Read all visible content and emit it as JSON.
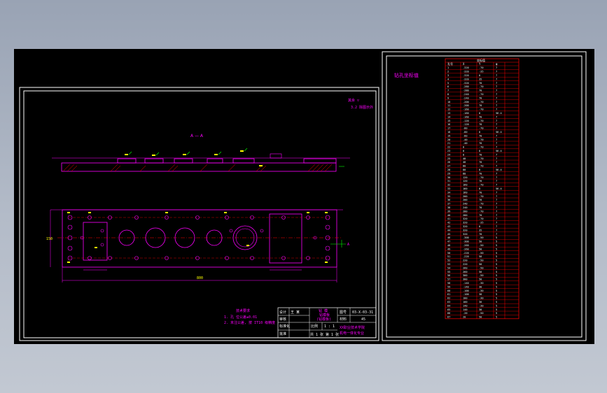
{
  "colors": {
    "background": "#000000",
    "frame": "#ffffff",
    "part_outline": "#ff00ff",
    "dimension": "#ff00ff",
    "centerline": "#ff0000",
    "hatch": "#ff0000",
    "table_grid": "#ff0000",
    "marker": "#ffff00",
    "leader": "#00ff00"
  },
  "drawing": {
    "section_label": "A — A",
    "view_arrow_label": "A",
    "top_right_note": [
      "其余 ▽",
      "3.2 除图示外"
    ],
    "tech_requirements": {
      "title": "技术要求",
      "lines": [
        "1. 孔 位公差±0.01",
        "2. 未注公差, 按 IT10 级精度"
      ]
    },
    "overall_dimension": "800",
    "side_dimension": "150"
  },
  "title_block": {
    "designer_label": "设计",
    "designer_name": "王 某",
    "checker_label": "审核",
    "standard_label": "标准化",
    "approve_label": "批准",
    "title_top": "钻 模",
    "title_sub": "(钻模板)",
    "title_center": "钻模板",
    "drawing_no_label": "图号",
    "drawing_no": "03-X-03-31",
    "material_label": "材料",
    "material": "45",
    "scale_label": "比例",
    "scale": "1 : 1",
    "sheet": "共 1 张 第 1 张",
    "school": "XX职业技术学院",
    "class": "机电一体化专业"
  },
  "coordinate_table": {
    "title": "钻孔坐标值",
    "header_caption": "坐标值",
    "columns": [
      "孔号",
      "X",
      "Y",
      "φ"
    ],
    "rows": [
      [
        "1",
        "-320",
        "-70",
        "7"
      ],
      [
        "2",
        "-320",
        "-35",
        "7"
      ],
      [
        "3",
        "-320",
        "0",
        "7"
      ],
      [
        "4",
        "-320",
        "35",
        "7"
      ],
      [
        "5",
        "-320",
        "70",
        "7"
      ],
      [
        "6",
        "-280",
        "-70",
        "7"
      ],
      [
        "7",
        "-280",
        "70",
        "7"
      ],
      [
        "8",
        "-240",
        "-70",
        "7"
      ],
      [
        "9",
        "-240",
        "70",
        "7"
      ],
      [
        "10",
        "-200",
        "-70",
        "7"
      ],
      [
        "11",
        "-200",
        "70",
        "7"
      ],
      [
        "12",
        "-160",
        "-70",
        "7"
      ],
      [
        "13",
        "-160",
        "0",
        "56.4"
      ],
      [
        "14",
        "-160",
        "70",
        "7"
      ],
      [
        "15",
        "-120",
        "-70",
        "7"
      ],
      [
        "16",
        "-120",
        "70",
        "7"
      ],
      [
        "17",
        "-80",
        "-70",
        "7"
      ],
      [
        "18",
        "-80",
        "0",
        "56.4"
      ],
      [
        "19",
        "-80",
        "70",
        "7"
      ],
      [
        "20",
        "-40",
        "-70",
        "7"
      ],
      [
        "21",
        "-40",
        "70",
        "7"
      ],
      [
        "22",
        "0",
        "-70",
        "7"
      ],
      [
        "23",
        "0",
        "0",
        "56.4"
      ],
      [
        "24",
        "0",
        "70",
        "7"
      ],
      [
        "25",
        "40",
        "-70",
        "7"
      ],
      [
        "26",
        "40",
        "70",
        "7"
      ],
      [
        "27",
        "80",
        "-70",
        "7"
      ],
      [
        "28",
        "80",
        "0",
        "56.4"
      ],
      [
        "29",
        "80",
        "70",
        "7"
      ],
      [
        "30",
        "120",
        "-70",
        "7"
      ],
      [
        "31",
        "120",
        "70",
        "7"
      ],
      [
        "32",
        "160",
        "-70",
        "7"
      ],
      [
        "33",
        "160",
        "0",
        "56.4"
      ],
      [
        "34",
        "160",
        "70",
        "7"
      ],
      [
        "35",
        "200",
        "-70",
        "7"
      ],
      [
        "36",
        "200",
        "70",
        "7"
      ],
      [
        "37",
        "240",
        "-70",
        "7"
      ],
      [
        "38",
        "240",
        "70",
        "7"
      ],
      [
        "39",
        "280",
        "-70",
        "7"
      ],
      [
        "40",
        "280",
        "70",
        "7"
      ],
      [
        "41",
        "320",
        "-70",
        "7"
      ],
      [
        "42",
        "320",
        "-35",
        "7"
      ],
      [
        "43",
        "320",
        "0",
        "7"
      ],
      [
        "44",
        "320",
        "35",
        "7"
      ],
      [
        "45",
        "320",
        "70",
        "7"
      ],
      [
        "46",
        "-300",
        "-50",
        "5"
      ],
      [
        "47",
        "-300",
        "50",
        "5"
      ],
      [
        "48",
        "-260",
        "-50",
        "5"
      ],
      [
        "49",
        "-260",
        "50",
        "5"
      ],
      [
        "50",
        "-220",
        "-50",
        "5"
      ],
      [
        "51",
        "-220",
        "50",
        "5"
      ],
      [
        "52",
        "220",
        "-50",
        "5"
      ],
      [
        "53",
        "220",
        "50",
        "5"
      ],
      [
        "54",
        "260",
        "-50",
        "5"
      ],
      [
        "55",
        "260",
        "50",
        "5"
      ],
      [
        "56",
        "300",
        "-50",
        "5"
      ],
      [
        "57",
        "300",
        "50",
        "5"
      ],
      [
        "58",
        "-140",
        "-30",
        "5"
      ],
      [
        "59",
        "-140",
        "30",
        "5"
      ],
      [
        "60",
        "-100",
        "-30",
        "5"
      ],
      [
        "61",
        "-100",
        "30",
        "5"
      ],
      [
        "62",
        "100",
        "-30",
        "5"
      ],
      [
        "63",
        "100",
        "30",
        "5"
      ],
      [
        "64",
        "140",
        "-30",
        "5"
      ],
      [
        "65",
        "140",
        "30",
        "5"
      ],
      [
        "66",
        "-20",
        "-50",
        "5"
      ],
      [
        "67",
        "20",
        "50",
        "5"
      ]
    ]
  }
}
